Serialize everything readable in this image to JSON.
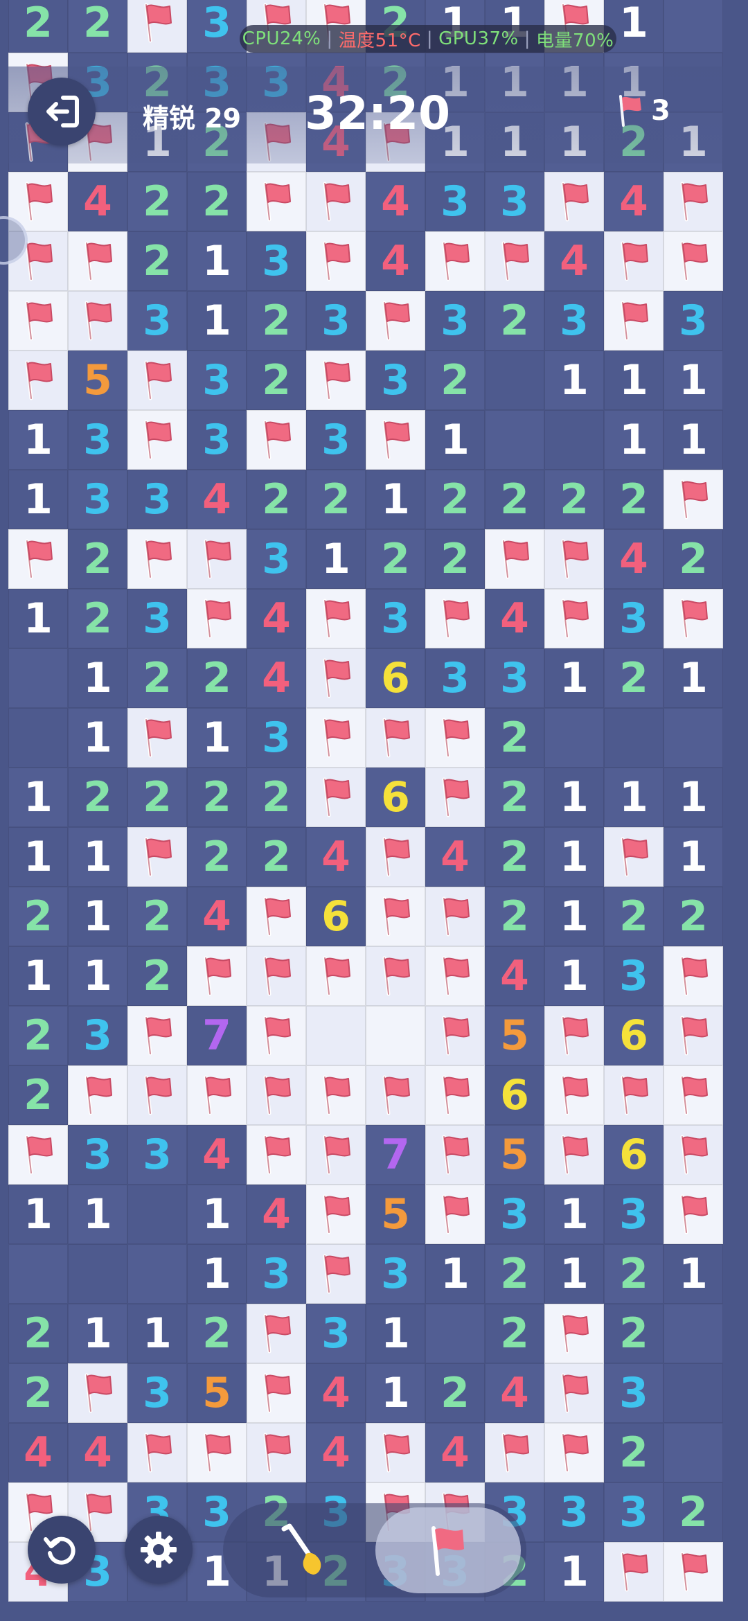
{
  "status_bar": {
    "cpu": "CPU24%",
    "temperature": "温度51°C",
    "gpu": "GPU37%",
    "battery": "电量70%"
  },
  "hud": {
    "level": "精锐 29",
    "timer": "32:20",
    "flags_remaining": "3"
  },
  "controls": {
    "exit": "exit-icon",
    "restart": "restart-icon",
    "settings": "gear-icon",
    "dig_mode": "shovel-icon",
    "flag_mode": "flag-icon",
    "active_mode": "flag"
  },
  "colors": {
    "1": "#ffffff",
    "2": "#86e3a8",
    "3": "#3fc3ee",
    "4": "#f2607d",
    "5": "#f49a3c",
    "6": "#f5e13a",
    "7": "#b367f0",
    "flag": "#f06a82"
  },
  "board": {
    "columns": 12,
    "rows": [
      [
        "2",
        "2",
        "F",
        "3",
        "F",
        "F",
        "2",
        "1",
        "1",
        "F",
        "1",
        ""
      ],
      [
        "F",
        "3",
        "2",
        "3",
        "3",
        "4",
        "2",
        "1",
        "1",
        "1",
        "1",
        ""
      ],
      [
        "F",
        "F",
        "1",
        "2",
        "F",
        "4",
        "F",
        "1",
        "1",
        "1",
        "2",
        "1"
      ],
      [
        "F",
        "4",
        "2",
        "2",
        "F",
        "F",
        "4",
        "3",
        "3",
        "F",
        "4",
        "F"
      ],
      [
        "F",
        "F",
        "2",
        "1",
        "3",
        "F",
        "4",
        "F",
        "F",
        "4",
        "F",
        "F"
      ],
      [
        "F",
        "F",
        "3",
        "1",
        "2",
        "3",
        "F",
        "3",
        "2",
        "3",
        "F",
        "3"
      ],
      [
        "F",
        "5",
        "F",
        "3",
        "2",
        "F",
        "3",
        "2",
        "",
        "1",
        "1",
        "1"
      ],
      [
        "1",
        "3",
        "F",
        "3",
        "F",
        "3",
        "F",
        "1",
        "",
        "",
        "1",
        "1"
      ],
      [
        "1",
        "3",
        "3",
        "4",
        "2",
        "2",
        "1",
        "2",
        "2",
        "2",
        "2",
        "F"
      ],
      [
        "F",
        "2",
        "F",
        "F",
        "3",
        "1",
        "2",
        "2",
        "F",
        "F",
        "4",
        "2"
      ],
      [
        "1",
        "2",
        "3",
        "F",
        "4",
        "F",
        "3",
        "F",
        "4",
        "F",
        "3",
        "F"
      ],
      [
        "",
        "1",
        "2",
        "2",
        "4",
        "F",
        "6",
        "3",
        "3",
        "1",
        "2",
        "1"
      ],
      [
        "",
        "1",
        "F",
        "1",
        "3",
        "F",
        "F",
        "F",
        "2",
        "",
        "",
        ""
      ],
      [
        "1",
        "2",
        "2",
        "2",
        "2",
        "F",
        "6",
        "F",
        "2",
        "1",
        "1",
        "1"
      ],
      [
        "1",
        "1",
        "F",
        "2",
        "2",
        "4",
        "F",
        "4",
        "2",
        "1",
        "F",
        "1"
      ],
      [
        "2",
        "1",
        "2",
        "4",
        "F",
        "6",
        "F",
        "F",
        "2",
        "1",
        "2",
        "2"
      ],
      [
        "1",
        "1",
        "2",
        "F",
        "F",
        "F",
        "F",
        "F",
        "4",
        "1",
        "3",
        "F"
      ],
      [
        "2",
        "3",
        "F",
        "7",
        "F",
        "",
        "",
        "F",
        "5",
        "F",
        "6",
        "F"
      ],
      [
        "2",
        "F",
        "F",
        "F",
        "F",
        "F",
        "F",
        "F",
        "6",
        "F",
        "F",
        "F"
      ],
      [
        "F",
        "3",
        "3",
        "4",
        "F",
        "F",
        "7",
        "F",
        "5",
        "F",
        "6",
        "F"
      ],
      [
        "1",
        "1",
        "",
        "1",
        "4",
        "F",
        "5",
        "F",
        "3",
        "1",
        "3",
        "F"
      ],
      [
        "",
        "",
        "",
        "1",
        "3",
        "F",
        "3",
        "1",
        "2",
        "1",
        "2",
        "1"
      ],
      [
        "2",
        "1",
        "1",
        "2",
        "F",
        "3",
        "1",
        "",
        "2",
        "F",
        "2",
        ""
      ],
      [
        "2",
        "F",
        "3",
        "5",
        "F",
        "4",
        "1",
        "2",
        "4",
        "F",
        "3",
        ""
      ],
      [
        "4",
        "4",
        "F",
        "F",
        "F",
        "4",
        "F",
        "4",
        "F",
        "F",
        "2",
        ""
      ],
      [
        "F",
        "F",
        "3",
        "3",
        "2",
        "3",
        "F",
        "F",
        "3",
        "3",
        "3",
        "2"
      ],
      [
        "4",
        "3",
        "",
        "1",
        "1",
        "2",
        "3",
        "3",
        "2",
        "1",
        "F",
        "F"
      ]
    ],
    "revealed_mask": [
      "DDLDLLDDDLDD",
      "LDDDDDDDDDDD",
      "DLDDLDLDDDDD",
      "LDDDLLDDDLDL",
      "LLDDDLDLLDLL",
      "LLDDDDLDDDLD",
      "LDLDDLDDDDDD",
      "DDLDLDLDDDDD",
      "DDDDDDDDDDDL",
      "LDLLDDDDLLDD",
      "DDDLDLDLDLDL",
      "DDDDDLDDDDDD",
      "DDLDDLLLDDDD",
      "DDDDDLDLDDDD",
      "DDLDDDLDDDLD",
      "DDDDLDLLDDDD",
      "DDDLLLLLDDDL",
      "DDLDLLLLDLDL",
      "DLLLLLLLDLLL",
      "LDDDLLDLDLDL",
      "DDDDDLDLDDDL",
      "DDDDDLDDDDDD",
      "DDDDLDDDDLDD",
      "DLDDLDDDDLDD",
      "DDLLLDLDLLDD",
      "LLDDDDLLDDDD",
      "LDDDDDDDDDLL"
    ]
  }
}
